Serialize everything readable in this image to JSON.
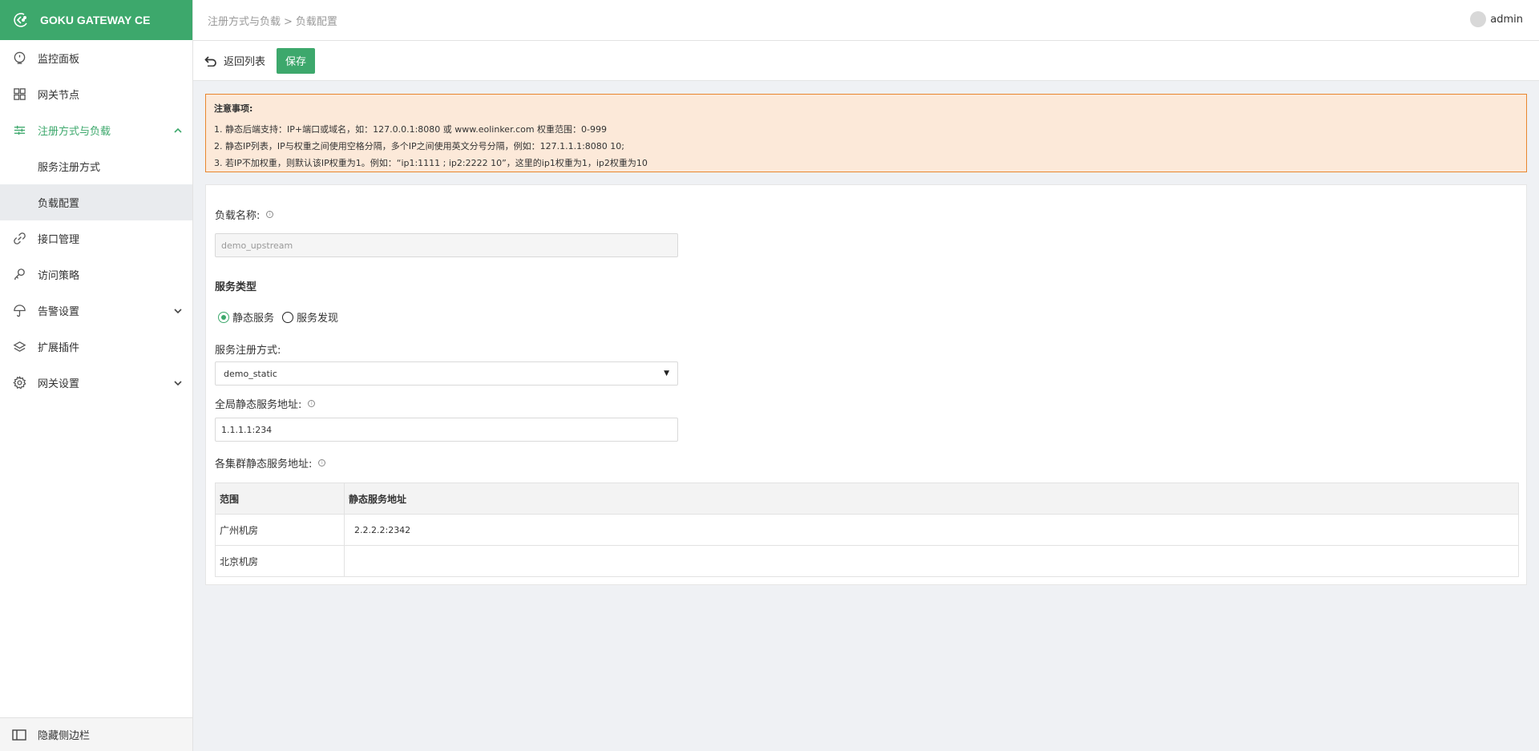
{
  "brand": {
    "title": "GOKU GATEWAY CE",
    "icon": "goku-logo-icon"
  },
  "sidebar": {
    "items": [
      {
        "label": "监控面板",
        "icon": "dashboard-icon"
      },
      {
        "label": "网关节点",
        "icon": "grid-icon"
      },
      {
        "label": "注册方式与负载",
        "icon": "sliders-icon",
        "expanded": true,
        "children": [
          {
            "label": "服务注册方式"
          },
          {
            "label": "负载配置",
            "selected": true
          }
        ]
      },
      {
        "label": "接口管理",
        "icon": "link-icon"
      },
      {
        "label": "访问策略",
        "icon": "key-icon"
      },
      {
        "label": "告警设置",
        "icon": "umbrella-icon"
      },
      {
        "label": "扩展插件",
        "icon": "layers-icon"
      },
      {
        "label": "网关设置",
        "icon": "gear-icon"
      }
    ],
    "footer_label": "隐藏侧边栏"
  },
  "header": {
    "breadcrumb": [
      "注册方式与负载",
      "负载配置"
    ],
    "breadcrumb_sep": ">",
    "user": "admin"
  },
  "toolbar": {
    "back_label": "返回列表",
    "save_label": "保存"
  },
  "notice": {
    "title": "注意事项:",
    "lines": [
      "1. 静态后端支持：IP+端口或域名，如：127.0.0.1:8080 或 www.eolinker.com 权重范围：0-999",
      "2. 静态IP列表，IP与权重之间使用空格分隔，多个IP之间使用英文分号分隔，例如：127.1.1.1:8080 10;",
      "3. 若IP不加权重，则默认该IP权重为1。例如：“ip1:1111 ; ip2:2222 10”，这里的ip1权重为1，ip2权重为10"
    ]
  },
  "form": {
    "name_label": "负载名称:",
    "name_value": "demo_upstream",
    "service_type_title": "服务类型",
    "radio_static": "静态服务",
    "radio_discovery": "服务发现",
    "reg_label": "服务注册方式:",
    "reg_value": "demo_static",
    "global_label": "全局静态服务地址:",
    "global_value": "1.1.1.1:234",
    "cluster_label": "各集群静态服务地址:",
    "table": {
      "headers": [
        "范围",
        "静态服务地址"
      ],
      "rows": [
        {
          "range": "广州机房",
          "address": "2.2.2.2:2342"
        },
        {
          "range": "北京机房",
          "address": ""
        }
      ]
    }
  },
  "colors": {
    "primary": "#3da86c",
    "notice_bg": "#fce9d9",
    "notice_border": "#e8862e"
  }
}
